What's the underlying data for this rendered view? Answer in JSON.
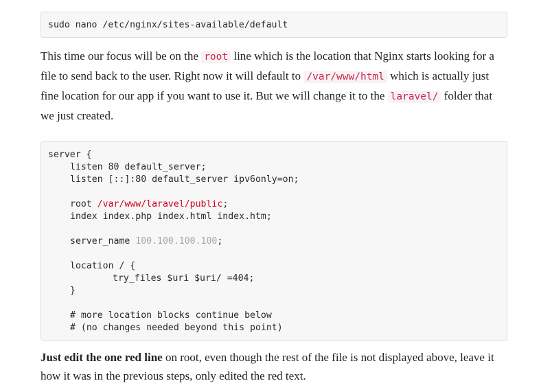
{
  "command_block": {
    "command": "sudo nano /etc/nginx/sites-available/default"
  },
  "intro_paragraph": {
    "t1": "This time our focus will be on the ",
    "code_root": "root",
    "t2": " line which is the location that Nginx starts looking for a file to send back to the user. Right now it will default to ",
    "code_default_path": "/var/www/html",
    "t3": " which is actually just fine location for our app if you want to use it. But we will change it to the ",
    "code_laravel": "laravel/",
    "t4": " folder that we just created."
  },
  "config_block": {
    "server_open": "server {",
    "listen_1": "listen 80 default_server;",
    "listen_2": "listen [::]:80 default_server ipv6only=on;",
    "root_prefix": "root ",
    "root_path": "/var/www/laravel/public",
    "root_suffix": ";",
    "index_line": "index index.php index.html index.htm;",
    "server_name_prefix": "server_name ",
    "server_name_value": "100.100.100.100",
    "server_name_suffix": ";",
    "location_open": "location / {",
    "try_files": "try_files $uri $uri/ =404;",
    "location_close": "}",
    "comment_1": "# more location blocks continue below",
    "comment_2": "# (no changes needed beyond this point)"
  },
  "closing_paragraph": {
    "bold": "Just edit the one red line",
    "rest": " on root, even though the rest of the file is not displayed above, leave it how it was in the previous steps, only edited the red text."
  },
  "colors": {
    "red_highlight": "#d0021b",
    "ip_gray": "#a6a6a6",
    "inline_code_text": "#c7254e",
    "inline_code_bg": "#f9f2f4",
    "code_block_bg": "#f7f7f7"
  }
}
